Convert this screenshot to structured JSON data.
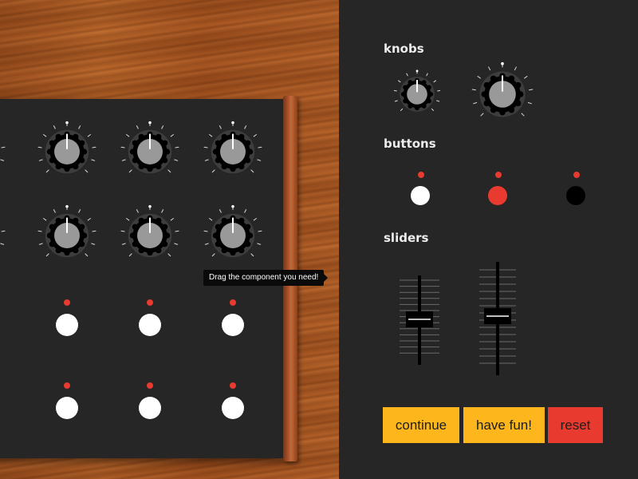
{
  "tooltip": {
    "text": "Drag the component you need!"
  },
  "palette": {
    "sections": {
      "knobs": "knobs",
      "buttons": "buttons",
      "sliders": "sliders"
    },
    "button_colors": [
      "#ffffff",
      "#e83a2e",
      "#000000"
    ],
    "actions": {
      "continue": "continue",
      "have_fun": "have fun!",
      "reset": "reset"
    },
    "action_colors": {
      "continue": "#fdb71d",
      "have_fun": "#fdb71d",
      "reset": "#e83a2e"
    }
  },
  "colors": {
    "led": "#e83a2e",
    "knob_cap": "#999999",
    "panel": "#262626",
    "wood": "#b25e26"
  }
}
